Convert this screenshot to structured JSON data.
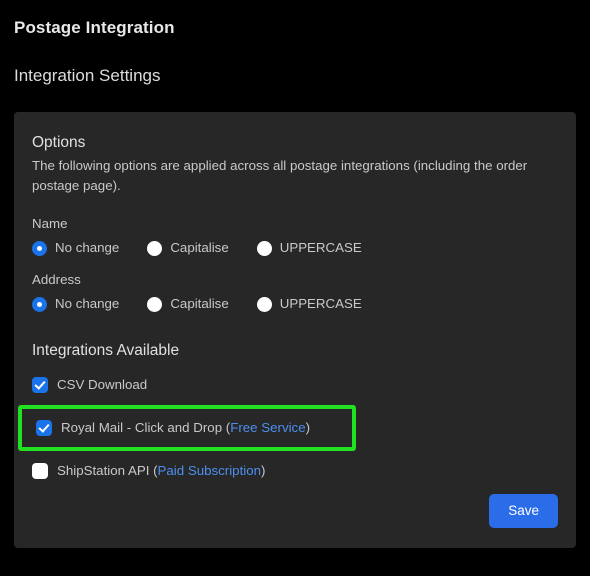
{
  "page": {
    "title": "Postage Integration",
    "section_title": "Integration Settings"
  },
  "options": {
    "heading": "Options",
    "description": "The following options are applied across all postage integrations (including the order postage page).",
    "groups": [
      {
        "name": "name",
        "label": "Name",
        "selected": "No change",
        "choices": [
          {
            "label": "No change",
            "checked": true
          },
          {
            "label": "Capitalise",
            "checked": false
          },
          {
            "label": "UPPERCASE",
            "checked": false
          }
        ]
      },
      {
        "name": "address",
        "label": "Address",
        "selected": "No change",
        "choices": [
          {
            "label": "No change",
            "checked": true
          },
          {
            "label": "Capitalise",
            "checked": false
          },
          {
            "label": "UPPERCASE",
            "checked": false
          }
        ]
      }
    ]
  },
  "integrations": {
    "heading": "Integrations Available",
    "items": [
      {
        "label": "CSV Download",
        "link_text": "",
        "suffix": "",
        "checked": true,
        "highlighted": false
      },
      {
        "label": "Royal Mail - Click and Drop (",
        "link_text": "Free Service",
        "suffix": ")",
        "checked": true,
        "highlighted": true
      },
      {
        "label": "ShipStation API (",
        "link_text": "Paid Subscription",
        "suffix": ")",
        "checked": false,
        "highlighted": false
      }
    ]
  },
  "actions": {
    "save_label": "Save"
  },
  "colors": {
    "page_background": "#000000",
    "panel_background": "#272727",
    "accent_blue": "#1a73e8",
    "button_blue": "#2b6ce8",
    "link_blue": "#4d8ff0",
    "highlight_green": "#22e022",
    "text_primary": "#e0e0e0",
    "text_secondary": "#c9c9c9"
  }
}
